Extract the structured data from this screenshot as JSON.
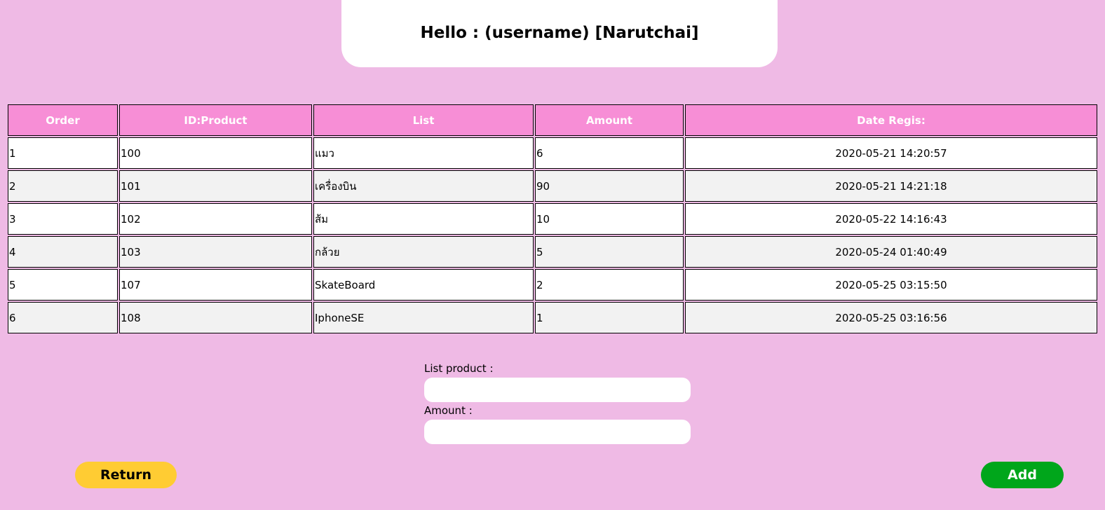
{
  "header": {
    "greeting": "Hello : (username) [Narutchai]"
  },
  "table": {
    "columns": [
      "Order",
      "ID:Product",
      "List",
      "Amount",
      "Date Regis:"
    ],
    "rows": [
      {
        "order": "1",
        "id": "100",
        "list": "แมว",
        "amount": "6",
        "date": "2020-05-21 14:20:57"
      },
      {
        "order": "2",
        "id": "101",
        "list": "เครื่องบิน",
        "amount": "90",
        "date": "2020-05-21 14:21:18"
      },
      {
        "order": "3",
        "id": "102",
        "list": "ส้ม",
        "amount": "10",
        "date": "2020-05-22 14:16:43"
      },
      {
        "order": "4",
        "id": "103",
        "list": "กล้วย",
        "amount": "5",
        "date": "2020-05-24 01:40:49"
      },
      {
        "order": "5",
        "id": "107",
        "list": "SkateBoard",
        "amount": "2",
        "date": "2020-05-25 03:15:50"
      },
      {
        "order": "6",
        "id": "108",
        "list": "IphoneSE",
        "amount": "1",
        "date": "2020-05-25 03:16:56"
      }
    ]
  },
  "form": {
    "list_label": "List product :",
    "list_value": "",
    "amount_label": "Amount :",
    "amount_value": ""
  },
  "buttons": {
    "return_label": "Return",
    "add_label": "Add"
  },
  "colors": {
    "background": "#efbae5",
    "header_cell": "#f78ed6",
    "return_button": "#ffcc33",
    "add_button": "#00a61b"
  }
}
